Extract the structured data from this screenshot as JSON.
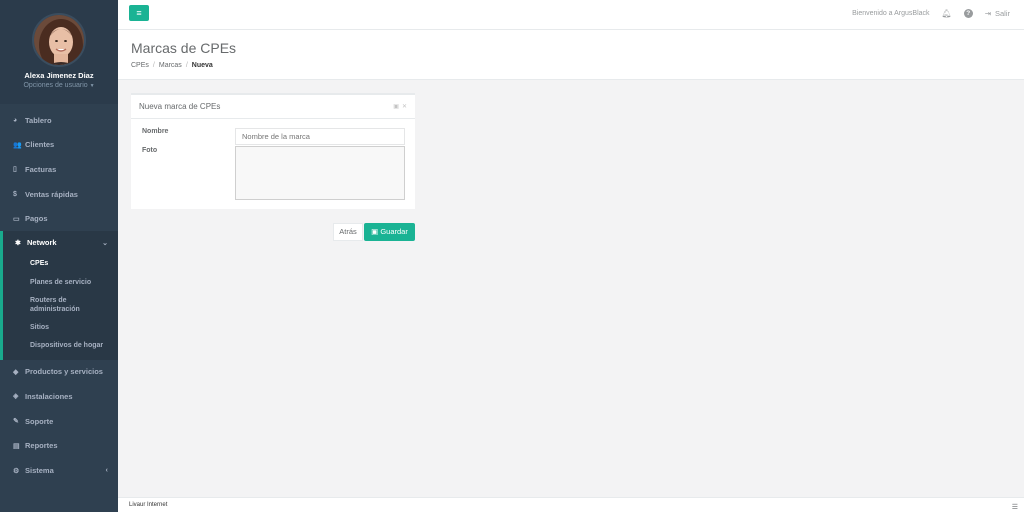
{
  "sidebar": {
    "user_name": "Alexa Jimenez Diaz",
    "user_options": "Opciones de usuario",
    "items_top": [
      {
        "label": "Tablero",
        "icon": "dashboard-icon"
      },
      {
        "label": "Clientes",
        "icon": "users-icon"
      },
      {
        "label": "Facturas",
        "icon": "file-icon"
      },
      {
        "label": "Ventas rápidas",
        "icon": "dollar-icon"
      },
      {
        "label": "Pagos",
        "icon": "money-icon"
      }
    ],
    "network": {
      "label": "Network",
      "icon": "sitemap-icon",
      "sub": [
        "CPEs",
        "Planes de servicio",
        "Routers de administración",
        "Sitios",
        "Dispositivos de hogar"
      ]
    },
    "items_bottom": [
      {
        "label": "Productos y servicios",
        "icon": "tag-icon"
      },
      {
        "label": "Instalaciones",
        "icon": "tools-icon"
      },
      {
        "label": "Soporte",
        "icon": "wrench-icon"
      },
      {
        "label": "Reportes",
        "icon": "book-icon"
      },
      {
        "label": "Sistema",
        "icon": "cogs-icon"
      }
    ]
  },
  "topbar": {
    "welcome": "Bienvenido a ArgusBlack",
    "logout": "Salir"
  },
  "heading": {
    "title": "Marcas de CPEs",
    "breadcrumb": [
      "CPEs",
      "Marcas",
      "Nueva"
    ]
  },
  "card": {
    "title": "Nueva marca de CPEs",
    "name_label": "Nombre",
    "name_placeholder": "Nombre de la marca",
    "photo_label": "Foto"
  },
  "actions": {
    "back": "Atrás",
    "save": "Guardar"
  },
  "footer": {
    "text": "Livaur Internet"
  },
  "colors": {
    "accent": "#1ab394",
    "sidebar_bg": "#2f4050"
  }
}
